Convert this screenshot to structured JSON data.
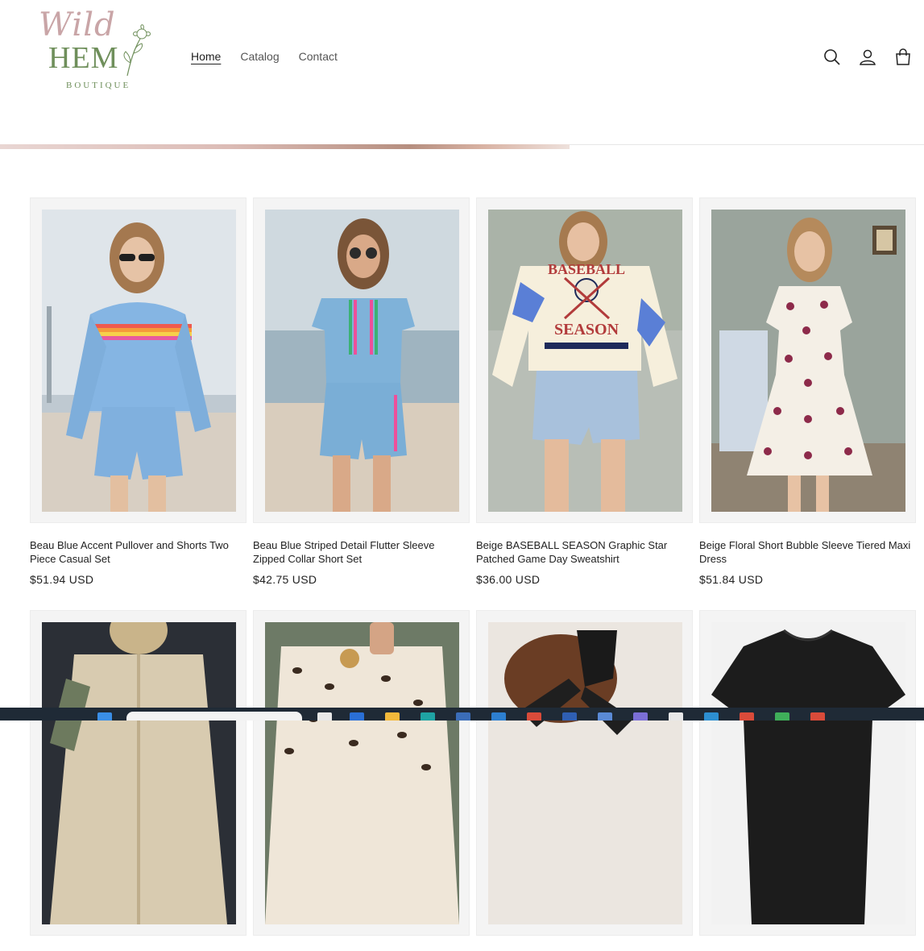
{
  "logo": {
    "line1": "Wild",
    "line2": "HEM",
    "line3": "BOUTIQUE"
  },
  "nav": {
    "home": "Home",
    "catalog": "Catalog",
    "contact": "Contact"
  },
  "icons": {
    "search": "search-icon",
    "account": "account-icon",
    "cart": "cart-icon"
  },
  "products": [
    {
      "title": "Beau Blue Accent Pullover and Shorts Two Piece Casual Set",
      "price": "$51.94 USD"
    },
    {
      "title": "Beau Blue Striped Detail Flutter Sleeve Zipped Collar Short Set",
      "price": "$42.75 USD"
    },
    {
      "title": "Beige BASEBALL SEASON Graphic Star Patched Game Day Sweatshirt",
      "price": "$36.00 USD"
    },
    {
      "title": "Beige Floral Short Bubble Sleeve Tiered Maxi Dress",
      "price": "$51.84 USD"
    },
    {
      "title": "",
      "price": ""
    },
    {
      "title": "",
      "price": ""
    },
    {
      "title": "",
      "price": ""
    },
    {
      "title": "",
      "price": ""
    }
  ],
  "colors": {
    "logo_pink": "#c9a5a7",
    "logo_green": "#6f8f5b",
    "text": "#222222"
  }
}
